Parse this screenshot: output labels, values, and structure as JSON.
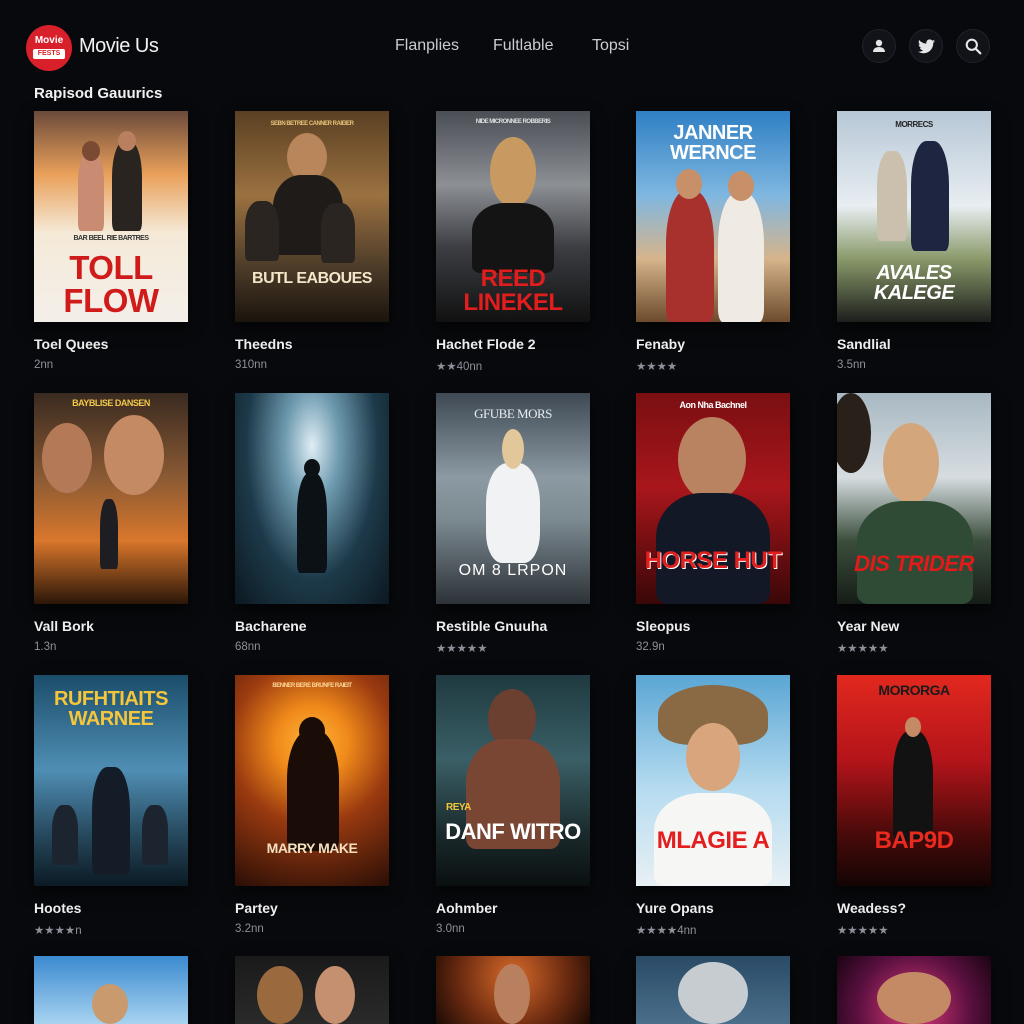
{
  "header": {
    "logo_top": "Movie",
    "logo_badge": "FESTS",
    "brand": "Movie Us",
    "nav": [
      "Flanplies",
      "Fultlable",
      "Topsi"
    ]
  },
  "section": {
    "title": "Rapisod Gauurics"
  },
  "movies": [
    {
      "title": "Toel Quees",
      "meta": "2nn",
      "poster_text": "TOLL FLOW",
      "poster_top": "BAR BEEL RIE BARTRES"
    },
    {
      "title": "Theedns",
      "meta": "310nn",
      "poster_text": "BUTL EABOUES",
      "poster_top": "SEBN BETREE   CANNER RAIEIER"
    },
    {
      "title": "Hachet Flode 2",
      "meta": "★★40nn",
      "poster_text": "REED LINEKEL",
      "poster_top": "NIDE MICRONNEE   ROBBERIS"
    },
    {
      "title": "Fenaby",
      "meta": "★★★★",
      "poster_text": "JANNER WERNCE",
      "poster_top": ""
    },
    {
      "title": "Sandlial",
      "meta": "3.5nn",
      "poster_text": "AVALES KALEGE",
      "poster_top": "MORRECS"
    },
    {
      "title": "Vall Bork",
      "meta": "1.3n",
      "poster_text": "",
      "poster_top": "BAYBLISE   DANSEN"
    },
    {
      "title": "Bacharene",
      "meta": "68nn",
      "poster_text": "",
      "poster_top": ""
    },
    {
      "title": "Restible Gnuuha",
      "meta": "★★★★★",
      "poster_text": "OM 8 LRPON",
      "poster_top": "GFUBE MORS"
    },
    {
      "title": "Sleopus",
      "meta": "32.9n",
      "poster_text": "HORSE HUT",
      "poster_top": "Aon Nha Bachnel"
    },
    {
      "title": "Year New",
      "meta": "★★★★★",
      "poster_text": "DIS TRIDER",
      "poster_top": ""
    },
    {
      "title": "Hootes",
      "meta": "★★★★n",
      "poster_text": "RUFHTIAITS WARNEE",
      "poster_top": ""
    },
    {
      "title": "Partey",
      "meta": "3.2nn",
      "poster_text": "MARRY MAKE",
      "poster_top": "BENNER BERE   BRUNFE RAIEIT"
    },
    {
      "title": "Aohmber",
      "meta": "3.0nn",
      "poster_text": "DANF WITRO",
      "poster_top": "REYA"
    },
    {
      "title": "Yure Opans",
      "meta": "★★★★4nn",
      "poster_text": "MLAGIE A",
      "poster_top": ""
    },
    {
      "title": "Weadess?",
      "meta": "★★★★★",
      "poster_text": "BAP9D",
      "poster_top": "MORORGA"
    }
  ],
  "colors": {
    "accent": "#d8202a",
    "background": "#08090c"
  }
}
